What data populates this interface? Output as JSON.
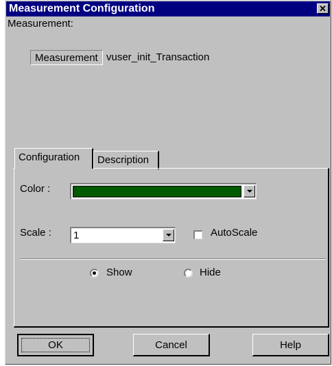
{
  "window": {
    "title": "Measurement Configuration",
    "close_glyph": "✕"
  },
  "measurement": {
    "label": "Measurement:",
    "field_label": "Measurement",
    "value": "vuser_init_Transaction"
  },
  "tabs": [
    {
      "label": "Configuration",
      "selected": true
    },
    {
      "label": "Description",
      "selected": false
    }
  ],
  "config": {
    "color_label": "Color :",
    "color_value": "#005a00",
    "scale_label": "Scale :",
    "scale_value": "1",
    "autoscale_label": "AutoScale",
    "autoscale_checked": false,
    "show_label": "Show",
    "hide_label": "Hide",
    "visibility": "Show"
  },
  "buttons": {
    "ok": "OK",
    "cancel": "Cancel",
    "help": "Help"
  }
}
